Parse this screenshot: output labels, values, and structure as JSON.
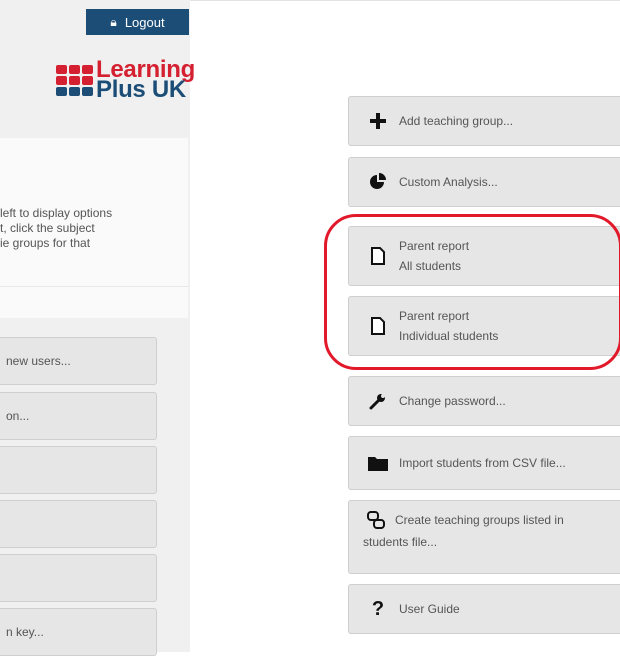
{
  "header": {
    "logout_label": "Logout"
  },
  "logo": {
    "line1": "Learning",
    "line2": "Plus UK",
    "colors": [
      "#d42030",
      "#1b4d76"
    ]
  },
  "info_panel": {
    "lines": [
      " left to display options",
      "t, click the subject",
      "ie groups for that"
    ]
  },
  "left_buttons": [
    {
      "label": "new users..."
    },
    {
      "label": "on..."
    },
    {
      "label": ""
    },
    {
      "label": ""
    },
    {
      "label": ""
    },
    {
      "label": "n key..."
    }
  ],
  "right_buttons": {
    "add_group": {
      "label": "Add teaching group...",
      "icon": "plus-icon"
    },
    "custom_analysis": {
      "label": "Custom Analysis...",
      "icon": "pie-chart-icon"
    },
    "parent_all": {
      "line1": "Parent report",
      "line2": "All students",
      "icon": "document-icon"
    },
    "parent_individual": {
      "line1": "Parent report",
      "line2": "Individual students",
      "icon": "document-icon"
    },
    "change_password": {
      "label": "Change password...",
      "icon": "wrench-icon"
    },
    "import_csv": {
      "label": "Import students from CSV file...",
      "icon": "folder-icon"
    },
    "create_groups": {
      "line1": "Create teaching groups listed in",
      "line2": "students file...",
      "icon": "groups-icon"
    },
    "user_guide": {
      "label": "User Guide",
      "icon": "question-icon"
    }
  },
  "highlight_color": "#e2192a"
}
